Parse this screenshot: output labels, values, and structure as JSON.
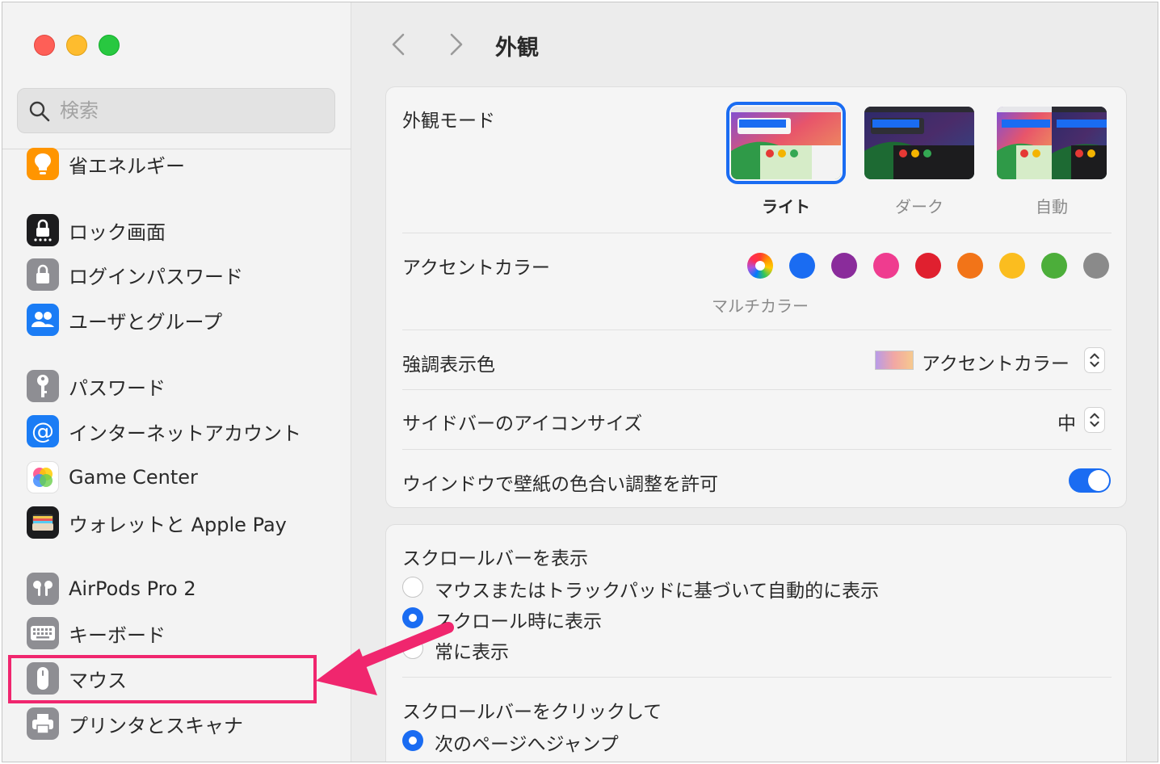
{
  "window": {
    "title": "外観"
  },
  "sidebar": {
    "search_placeholder": "検索",
    "items": [
      {
        "label": "省エネルギー",
        "icon": "lightbulb-icon",
        "color": "#ff9500"
      },
      {
        "label": "ロック画面",
        "icon": "lock-screen-icon",
        "color": "#1c1c1e"
      },
      {
        "label": "ログインパスワード",
        "icon": "lock-icon",
        "color": "#8e8e93"
      },
      {
        "label": "ユーザとグループ",
        "icon": "users-icon",
        "color": "#1a7cf5"
      },
      {
        "label": "パスワード",
        "icon": "key-icon",
        "color": "#8e8e93"
      },
      {
        "label": "インターネットアカウント",
        "icon": "at-icon",
        "color": "#1a7cf5"
      },
      {
        "label": "Game Center",
        "icon": "game-center-icon",
        "color": "#ffffff"
      },
      {
        "label": "ウォレットと Apple Pay",
        "icon": "wallet-icon",
        "color": "#1c1c1e"
      },
      {
        "label": "AirPods Pro 2",
        "icon": "airpods-icon",
        "color": "#8e8e93"
      },
      {
        "label": "キーボード",
        "icon": "keyboard-icon",
        "color": "#8e8e93"
      },
      {
        "label": "マウス",
        "icon": "mouse-icon",
        "color": "#8e8e93"
      },
      {
        "label": "プリンタとスキャナ",
        "icon": "printer-icon",
        "color": "#8e8e93"
      }
    ]
  },
  "appearance": {
    "mode_label": "外観モード",
    "modes": [
      {
        "label": "ライト",
        "selected": true
      },
      {
        "label": "ダーク",
        "selected": false
      },
      {
        "label": "自動",
        "selected": false
      }
    ],
    "accent_label": "アクセントカラー",
    "accent_caption": "マルチカラー",
    "accent_colors": [
      "multicolor",
      "#1a6cf2",
      "#8a2c9b",
      "#ef3c8f",
      "#e0202f",
      "#f27418",
      "#fbbd1f",
      "#4cae3a",
      "#8a8a8a"
    ],
    "highlight_label": "強調表示色",
    "highlight_value": "アクセントカラー",
    "sidebar_icon_label": "サイドバーのアイコンサイズ",
    "sidebar_icon_value": "中",
    "tint_label": "ウインドウで壁紙の色合い調整を許可",
    "tint_on": true
  },
  "scrollbars": {
    "show_label": "スクロールバーを表示",
    "show_options": [
      {
        "label": "マウスまたはトラックパッドに基づいて自動的に表示",
        "selected": false
      },
      {
        "label": "スクロール時に表示",
        "selected": true
      },
      {
        "label": "常に表示",
        "selected": false
      }
    ],
    "click_label": "スクロールバーをクリックして",
    "click_options": [
      {
        "label": "次のページへジャンプ",
        "selected": true
      }
    ]
  },
  "annotation": {
    "color": "#f0266e"
  }
}
